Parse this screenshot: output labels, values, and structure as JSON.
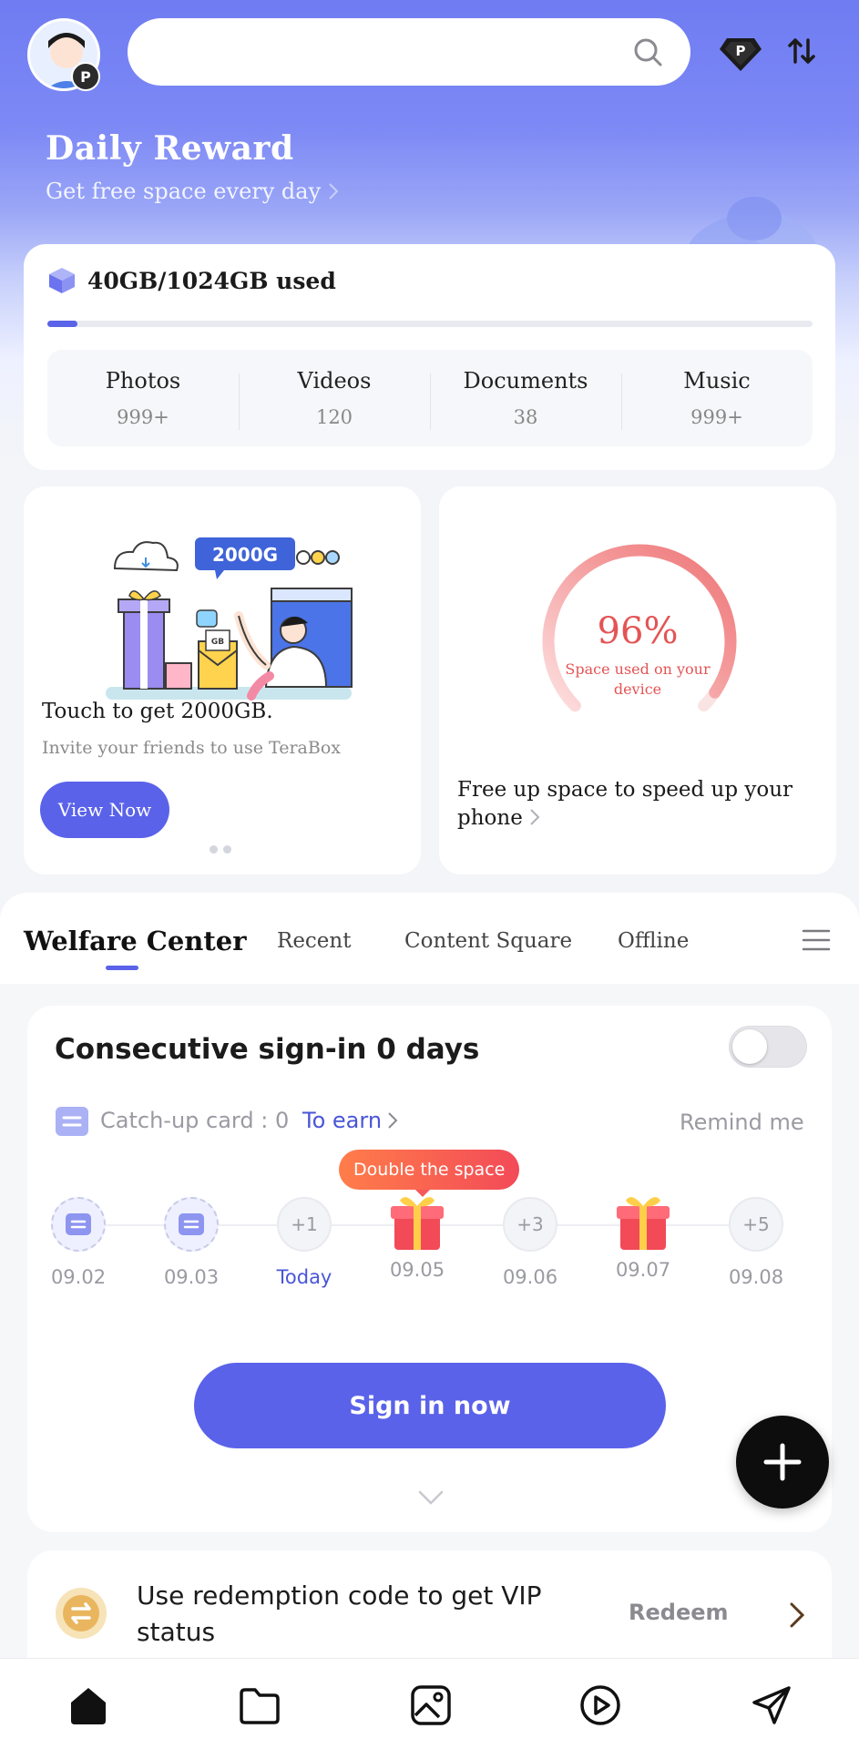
{
  "header": {
    "search_placeholder": "",
    "avatar_badge": "P"
  },
  "daily_reward": {
    "title": "Daily Reward",
    "subtitle": "Get free space every day"
  },
  "storage": {
    "used_text": "40GB/1024GB used",
    "used_fraction": 0.039,
    "stats": [
      {
        "label": "Photos",
        "value": "999+"
      },
      {
        "label": "Videos",
        "value": "120"
      },
      {
        "label": "Documents",
        "value": "38"
      },
      {
        "label": "Music",
        "value": "999+"
      }
    ]
  },
  "promo": {
    "badge": "2000G",
    "gb_tag": "GB",
    "title": "Touch to get 2000GB.",
    "description": "Invite your friends to use TeraBox",
    "button": "View Now"
  },
  "device": {
    "percent": "96%",
    "percent_value": 0.96,
    "caption": "Space used on your device",
    "free_text": "Free up space to speed up your phone"
  },
  "tabs": [
    {
      "label": "Welfare Center",
      "active": true
    },
    {
      "label": "Recent",
      "active": false
    },
    {
      "label": "Content Square",
      "active": false
    },
    {
      "label": "Offline",
      "active": false
    }
  ],
  "signin": {
    "title": "Consecutive sign-in 0 days",
    "catchup": "Catch-up card : 0",
    "to_earn": "To earn",
    "remind": "Remind me",
    "tip": "Double the space",
    "button": "Sign in now",
    "days": [
      {
        "date": "09.02",
        "kind": "card",
        "label": ""
      },
      {
        "date": "09.03",
        "kind": "card",
        "label": ""
      },
      {
        "date": "Today",
        "kind": "plus",
        "label": "+1"
      },
      {
        "date": "09.05",
        "kind": "gift",
        "label": ""
      },
      {
        "date": "09.06",
        "kind": "plus",
        "label": "+3"
      },
      {
        "date": "09.07",
        "kind": "gift",
        "label": ""
      },
      {
        "date": "09.08",
        "kind": "plus",
        "label": "+5"
      }
    ]
  },
  "redeem": {
    "text": "Use redemption code to get VIP status",
    "button": "Redeem"
  },
  "nav": [
    "home-icon",
    "folder-icon",
    "photo-icon",
    "play-icon",
    "send-icon"
  ],
  "colors": {
    "accent": "#5a62ea",
    "gauge": "#e45455",
    "gift": "#f34a58"
  }
}
